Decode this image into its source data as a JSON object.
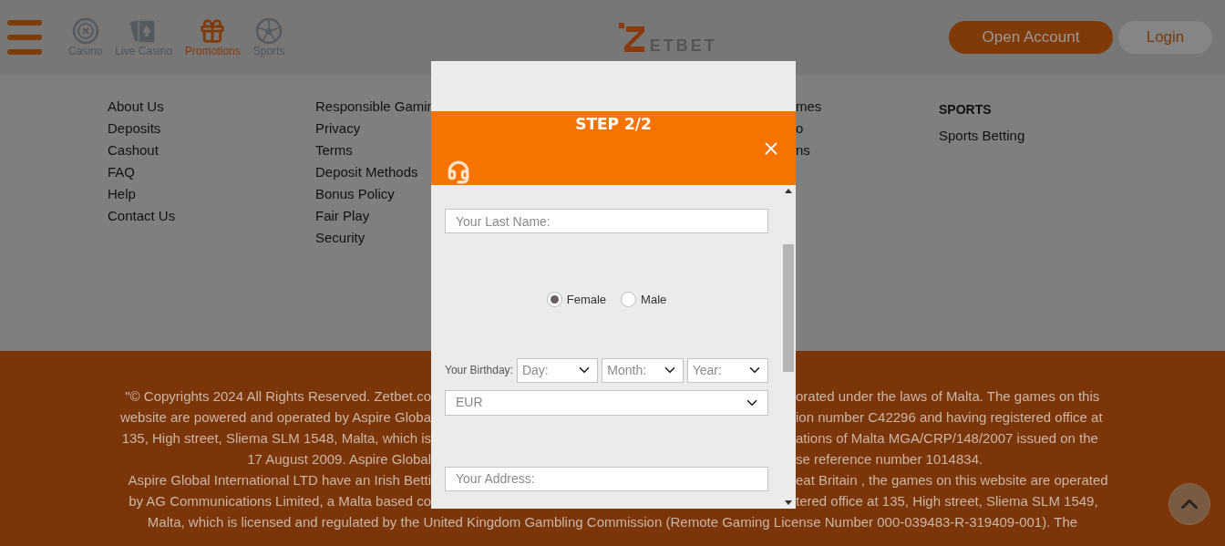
{
  "header": {
    "nav": [
      {
        "label": "Casino",
        "selected": false
      },
      {
        "label": "Live Casino",
        "selected": false
      },
      {
        "label": "Promotions",
        "selected": true
      },
      {
        "label": "Sports",
        "selected": false
      }
    ],
    "logo": "ETBET",
    "open_account": "Open Account",
    "login": "Login"
  },
  "link_columns": [
    {
      "items": [
        "About Us",
        "Deposits",
        "Cashout",
        "FAQ",
        "Help",
        "Contact Us"
      ]
    },
    {
      "items": [
        "Responsible Gamin",
        "Privacy",
        "Terms",
        "Deposit Methods",
        "Bonus Policy",
        "Fair Play",
        "Security"
      ]
    },
    {
      "items": [
        "mes",
        "o",
        "ns"
      ]
    },
    {
      "heading": "SPORTS",
      "items": [
        "Sports Betting"
      ]
    }
  ],
  "legal": [
    {
      "left": "\"© Copyrights 2024 All Rights Reserved. Zetbet.co",
      "right": "orated under the laws of Malta. The games on this"
    },
    {
      "left": "website are powered and operated by Aspire Globa",
      "right": "ion number C42296 and having registered office at"
    },
    {
      "left": "135, High street, Sliema SLM 1548, Malta, which is",
      "right": "ations of Malta MGA/CRP/148/2007 issued on the"
    },
    {
      "left": "17 August 2009. Aspire Global",
      "right": "se reference number 1014834."
    },
    {
      "left": "Aspire Global International LTD have an Irish Betti",
      "right": "eat Britain , the games on this website are operated"
    },
    {
      "left": "by AG Communications Limited, a Malta based co",
      "right": "tered office at 135, High street, Sliema SLM 1549,"
    }
  ],
  "legal_last": "Malta, which is licensed and regulated by the United Kingdom Gambling Commission (Remote Gaming License Number 000-039483-R-319409-001). The",
  "modal": {
    "title": "STEP 2/2",
    "last_name": {
      "placeholder": "Your Last Name:"
    },
    "gender": [
      {
        "label": "Female",
        "selected": true
      },
      {
        "label": "Male",
        "selected": false
      }
    ],
    "birthday_label": "Your Birthday:",
    "birthday": [
      {
        "placeholder": "Day:"
      },
      {
        "placeholder": "Month:"
      },
      {
        "placeholder": "Year:"
      }
    ],
    "currency": {
      "value": "EUR"
    },
    "address": {
      "placeholder": "Your Address:"
    }
  }
}
